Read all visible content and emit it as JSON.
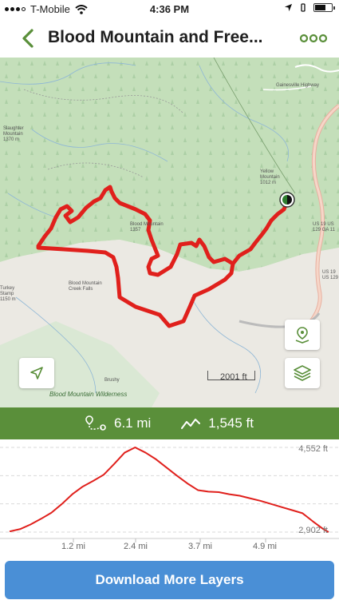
{
  "status_bar": {
    "carrier": "T-Mobile",
    "time": "4:36 PM"
  },
  "header": {
    "title": "Blood Mountain and Free..."
  },
  "map": {
    "scale_label": "2001 ft",
    "labels": {
      "wilderness": "Blood Mountain Wilderness",
      "creek_falls": "Blood Mountain Creek Falls",
      "peak": "Blood Mountain 1357",
      "yellow_mountain": "Yellow Mountain 1012 m",
      "slaughter": "Slaughter Mountain 1370 m",
      "turkey": "Turkey Stamp 1150 m",
      "brushy": "Brushy",
      "highway": "Gainesville Highway",
      "us19_top": "US 19 US 129 GA 11",
      "us19_bottom": "US 19 US 129"
    }
  },
  "stats": {
    "distance": "6.1 mi",
    "elevation_gain": "1,545 ft"
  },
  "chart_data": {
    "type": "line",
    "xlabel": "",
    "ylabel": "",
    "x_ticks": [
      "1.2 mi",
      "2.4 mi",
      "3.7 mi",
      "4.9 mi"
    ],
    "y_max_label": "4,552 ft",
    "y_min_label": "2,902 ft",
    "ylim": [
      2902,
      4552
    ],
    "xlim": [
      0,
      6.1
    ],
    "series": [
      {
        "x": [
          0,
          0.2,
          0.4,
          0.6,
          0.8,
          1.0,
          1.2,
          1.4,
          1.6,
          1.8,
          2.0,
          2.2,
          2.4,
          2.6,
          2.8,
          3.0,
          3.2,
          3.4,
          3.6,
          3.8,
          4.0,
          4.2,
          4.4,
          4.6,
          4.8,
          5.0,
          5.2,
          5.4,
          5.6,
          5.8,
          6.0,
          6.1
        ],
        "y": [
          2915,
          2960,
          3050,
          3160,
          3280,
          3450,
          3640,
          3790,
          3900,
          4020,
          4230,
          4450,
          4552,
          4450,
          4320,
          4160,
          4000,
          3850,
          3720,
          3690,
          3680,
          3640,
          3610,
          3560,
          3510,
          3450,
          3390,
          3330,
          3270,
          3110,
          2960,
          2902
        ]
      }
    ],
    "grid": true,
    "color": "#e0201c"
  },
  "download": {
    "label": "Download More Layers"
  },
  "colors": {
    "brand_green": "#5a8f3a",
    "route_red": "#e0201c",
    "button_blue": "#4a8fd6"
  }
}
